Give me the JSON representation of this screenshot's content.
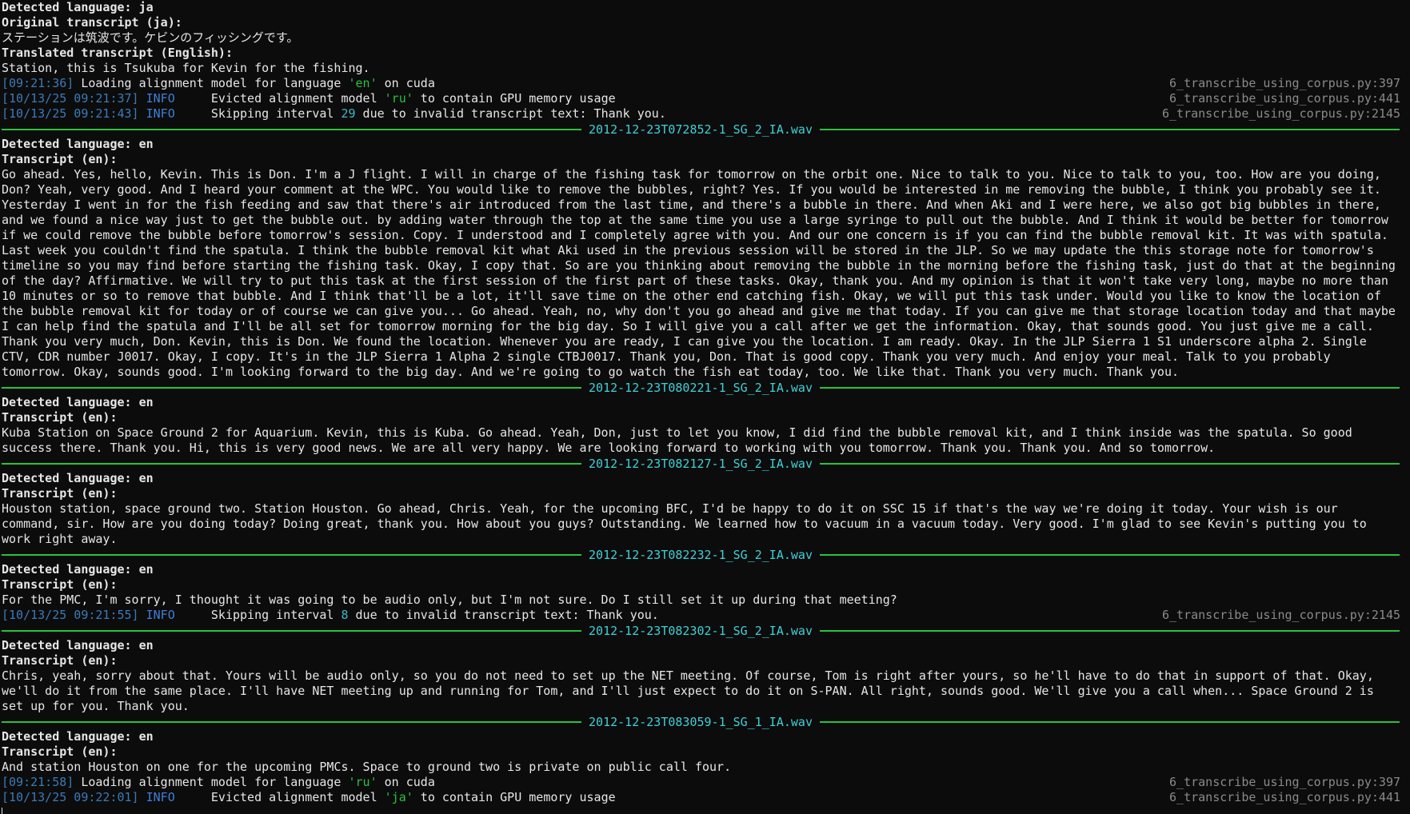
{
  "block0": {
    "detected": "Detected language: ja",
    "orig_label": "Original transcript (ja):",
    "orig_text": "ステーションは筑波です。ケビンのフィッシングです。",
    "trans_label": "Translated transcript (English):",
    "trans_text": "Station, this is Tsukuba for Kevin for the fishing.",
    "log1": {
      "time": "[09:21:36]",
      "pre": " Loading alignment model for language ",
      "lang": "'en'",
      "post": " on cuda",
      "src": "6_transcribe_using_corpus.py:397"
    },
    "log2": {
      "time": "[10/13/25 09:21:37]",
      "level": "INFO",
      "pre": "     Evicted alignment model ",
      "lang": "'ru'",
      "post": " to contain GPU memory usage",
      "src": "6_transcribe_using_corpus.py:441"
    },
    "log3": {
      "time": "[10/13/25 09:21:43]",
      "level": "INFO",
      "pre": "     Skipping interval ",
      "num": "29",
      "post": " due to invalid transcript text: Thank you.",
      "src": "6_transcribe_using_corpus.py:2145"
    }
  },
  "sep1": "2012-12-23T072852-1_SG_2_IA.wav",
  "block1": {
    "detected": "Detected language: en",
    "label": "Transcript (en):",
    "text": "Go ahead. Yes, hello, Kevin. This is Don. I'm a J flight. I will in charge of the fishing task for tomorrow on the orbit one. Nice to talk to you. Nice to talk to you, too. How are you doing, Don? Yeah, very good. And I heard your comment at the WPC. You would like to remove the bubbles, right? Yes. If you would be interested in me removing the bubble, I think you probably see it. Yesterday I went in for the fish feeding and saw that there's air introduced from the last time, and there's a bubble in there. And when Aki and I were here, we also got big bubbles in there, and we found a nice way just to get the bubble out. by adding water through the top at the same time you use a large syringe to pull out the bubble. And I think it would be better for tomorrow if we could remove the bubble before tomorrow's session. Copy. I understood and I completely agree with you. And our one concern is if you can find the bubble removal kit. It was with spatula. Last week you couldn't find the spatula. I think the bubble removal kit what Aki used in the previous session will be stored in the JLP. So we may update the this storage note for tomorrow's timeline so you may find before starting the fishing task. Okay, I copy that. So are you thinking about removing the bubble in the morning before the fishing task, just do that at the beginning of the day? Affirmative. We will try to put this task at the first session of the first part of these tasks. Okay, thank you. And my opinion is that it won't take very long, maybe no more than 10 minutes or so to remove that bubble. And I think that'll be a lot, it'll save time on the other end catching fish. Okay, we will put this task under. Would you like to know the location of the bubble removal kit for today or of course we can give you... Go ahead. Yeah, no, why don't you go ahead and give me that today. If you can give me that storage location today and that maybe I can help find the spatula and I'll be all set for tomorrow morning for the big day. So I will give you a call after we get the information. Okay, that sounds good. You just give me a call. Thank you very much, Don. Kevin, this is Don. We found the location. Whenever you are ready, I can give you the location. I am ready. Okay. In the JLP Sierra 1 S1 underscore alpha 2. Single CTV, CDR number J0017. Okay, I copy. It's in the JLP Sierra 1 Alpha 2 single CTBJ0017. Thank you, Don. That is good copy. Thank you very much. And enjoy your meal. Talk to you probably tomorrow. Okay, sounds good. I'm looking forward to the big day. And we're going to go watch the fish eat today, too. We like that. Thank you very much. Thank you."
  },
  "sep2": "2012-12-23T080221-1_SG_2_IA.wav",
  "block2": {
    "detected": "Detected language: en",
    "label": "Transcript (en):",
    "text": "Kuba Station on Space Ground 2 for Aquarium. Kevin, this is Kuba. Go ahead. Yeah, Don, just to let you know, I did find the bubble removal kit, and I think inside was the spatula. So good success there. Thank you. Hi, this is very good news. We are all very happy. We are looking forward to working with you tomorrow. Thank you. Thank you. And so tomorrow."
  },
  "sep3": "2012-12-23T082127-1_SG_2_IA.wav",
  "block3": {
    "detected": "Detected language: en",
    "label": "Transcript (en):",
    "text": "Houston station, space ground two. Station Houston. Go ahead, Chris. Yeah, for the upcoming BFC, I'd be happy to do it on SSC 15 if that's the way we're doing it today. Your wish is our command, sir. How are you doing today? Doing great, thank you. How about you guys? Outstanding. We learned how to vacuum in a vacuum today. Very good. I'm glad to see Kevin's putting you to work right away."
  },
  "sep4": "2012-12-23T082232-1_SG_2_IA.wav",
  "block4": {
    "detected": "Detected language: en",
    "label": "Transcript (en):",
    "text": "For the PMC, I'm sorry, I thought it was going to be audio only, but I'm not sure. Do I still set it up during that meeting?",
    "log1": {
      "time": "[10/13/25 09:21:55]",
      "level": "INFO",
      "pre": "     Skipping interval ",
      "num": "8",
      "post": " due to invalid transcript text: Thank you.",
      "src": "6_transcribe_using_corpus.py:2145"
    }
  },
  "sep5": "2012-12-23T082302-1_SG_2_IA.wav",
  "block5": {
    "detected": "Detected language: en",
    "label": "Transcript (en):",
    "text": "Chris, yeah, sorry about that. Yours will be audio only, so you do not need to set up the NET meeting. Of course, Tom is right after yours, so he'll have to do that in support of that. Okay, we'll do it from the same place. I'll have NET meeting up and running for Tom, and I'll just expect to do it on S-PAN. All right, sounds good. We'll give you a call when... Space Ground 2 is set up for you. Thank you."
  },
  "sep6": "2012-12-23T083059-1_SG_1_IA.wav",
  "block6": {
    "detected": "Detected language: en",
    "label": "Transcript (en):",
    "text": "And station Houston on one for the upcoming PMCs. Space to ground two is private on public call four.",
    "log1": {
      "time": "[09:21:58]",
      "pre": " Loading alignment model for language ",
      "lang": "'ru'",
      "post": " on cuda",
      "src": "6_transcribe_using_corpus.py:397"
    },
    "log2": {
      "time": "[10/13/25 09:22:01]",
      "level": "INFO",
      "pre": "     Evicted alignment model ",
      "lang": "'ja'",
      "post": " to contain GPU memory usage",
      "src": "6_transcribe_using_corpus.py:441"
    }
  },
  "colors": {
    "background": "#0c0c0c",
    "text": "#e6e6e6",
    "separator": "#27c33c",
    "filename": "#3fd0d8",
    "info": "#3e7fd8",
    "lang_string": "#27c33c",
    "source_ref": "#8a8a8a"
  }
}
